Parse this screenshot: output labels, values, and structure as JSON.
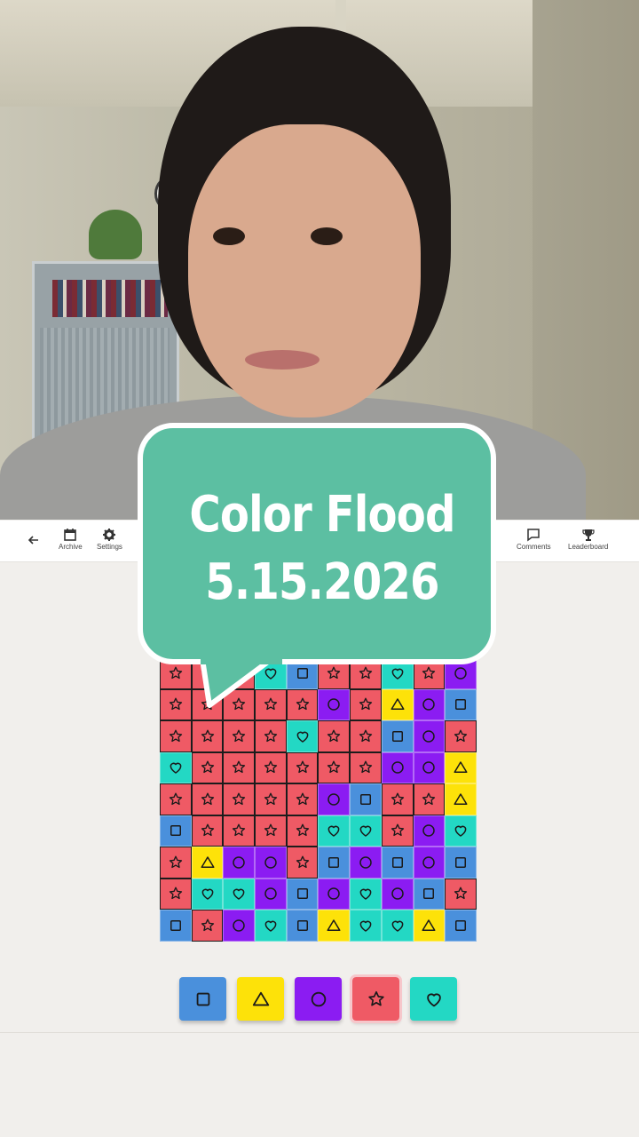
{
  "overlay": {
    "title_line1": "Color Flood",
    "title_line2": "5.15.2026"
  },
  "toolbar": {
    "back_icon": "arrow-left-icon",
    "archive_label": "Archive",
    "settings_label": "Settings",
    "comments_label": "Comments",
    "leaderboard_label": "Leaderboard"
  },
  "colors": {
    "red": "#ef5a65",
    "blue": "#4a90dc",
    "yellow": "#fde209",
    "purple": "#8b1cf2",
    "teal": "#23d8c4",
    "bubble": "#5cbfa2"
  },
  "legend": {
    "red": "star",
    "blue": "square",
    "yellow": "triangle",
    "purple": "circle",
    "teal": "heart"
  },
  "board": {
    "columns": 10,
    "rows": [
      [
        "red",
        "red",
        "red",
        "teal",
        "blue",
        "red",
        "red",
        "teal",
        "red",
        "purple"
      ],
      [
        "red",
        "red",
        "red",
        "red",
        "red",
        "purple",
        "red",
        "yellow",
        "purple",
        "blue"
      ],
      [
        "red",
        "red",
        "red",
        "red",
        "teal",
        "red",
        "red",
        "blue",
        "purple",
        "red"
      ],
      [
        "teal",
        "red",
        "red",
        "red",
        "red",
        "red",
        "red",
        "purple",
        "purple",
        "yellow"
      ],
      [
        "red",
        "red",
        "red",
        "red",
        "red",
        "purple",
        "blue",
        "red",
        "red",
        "yellow"
      ],
      [
        "blue",
        "red",
        "red",
        "red",
        "red",
        "teal",
        "teal",
        "red",
        "purple",
        "teal"
      ],
      [
        "red",
        "yellow",
        "purple",
        "purple",
        "red",
        "blue",
        "purple",
        "blue",
        "purple",
        "blue"
      ],
      [
        "red",
        "teal",
        "teal",
        "purple",
        "blue",
        "purple",
        "teal",
        "purple",
        "blue",
        "red"
      ],
      [
        "blue",
        "red",
        "purple",
        "teal",
        "blue",
        "yellow",
        "teal",
        "teal",
        "yellow",
        "blue"
      ]
    ]
  },
  "palette": [
    {
      "color": "blue",
      "shape": "square",
      "selected": false
    },
    {
      "color": "yellow",
      "shape": "triangle",
      "selected": false
    },
    {
      "color": "purple",
      "shape": "circle",
      "selected": false
    },
    {
      "color": "red",
      "shape": "star",
      "selected": true
    },
    {
      "color": "teal",
      "shape": "heart",
      "selected": false
    }
  ]
}
